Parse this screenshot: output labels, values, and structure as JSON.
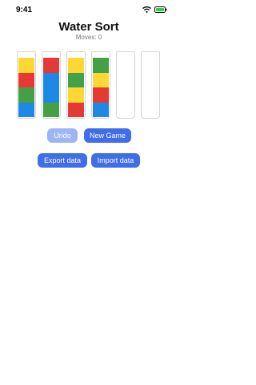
{
  "status_bar": {
    "time": "9:41",
    "icons": [
      "wifi-icon",
      "battery-icon"
    ]
  },
  "header": {
    "title": "Water Sort",
    "moves_text": "Moves: 0"
  },
  "colors": {
    "yellow": "#fdd835",
    "red": "#e53935",
    "green": "#43a047",
    "blue": "#1e88e5",
    "accent": "#3f6ee8",
    "accent_disabled": "#9fb4f5"
  },
  "tubes": [
    {
      "layers_top_to_bottom": [
        "yellow",
        "red",
        "green",
        "blue"
      ]
    },
    {
      "layers_top_to_bottom": [
        "red",
        "blue",
        "blue",
        "green"
      ]
    },
    {
      "layers_top_to_bottom": [
        "yellow",
        "green",
        "yellow",
        "red"
      ]
    },
    {
      "layers_top_to_bottom": [
        "green",
        "yellow",
        "red",
        "blue"
      ]
    },
    {
      "layers_top_to_bottom": []
    },
    {
      "layers_top_to_bottom": []
    }
  ],
  "buttons": {
    "undo": {
      "label": "Undo",
      "disabled": true
    },
    "new_game": {
      "label": "New Game"
    },
    "export": {
      "label": "Export data"
    },
    "import": {
      "label": "Import data"
    }
  }
}
